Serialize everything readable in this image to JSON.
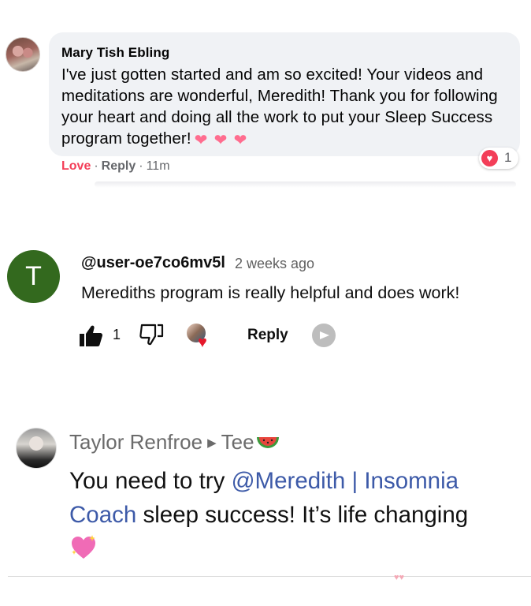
{
  "facebook_comment": {
    "author": "Mary Tish Ebling",
    "text": "I've just gotten started and am so excited! Your videos and meditations are wonderful, Meredith! Thank you for following your heart and doing all the work to put your Sleep Success program together!",
    "emoji": [
      "❤",
      "❤",
      "❤"
    ],
    "reaction_count": "1",
    "actions": {
      "love_label": "Love",
      "separator": "·",
      "reply_label": "Reply",
      "timestamp": "11m"
    },
    "colors": {
      "love": "#f33e58",
      "bubble": "#f0f2f5",
      "muted": "#65676b"
    }
  },
  "youtube_comment": {
    "avatar_letter": "T",
    "handle": "@user-oe7co6mv5l",
    "time": "2 weeks ago",
    "text": "Merediths program is really helpful and does work!",
    "like_count": "1",
    "reply_label": "Reply",
    "icons": [
      "thumbs-up-icon",
      "thumbs-down-icon",
      "creator-heart-icon",
      "translate-icon"
    ],
    "colors": {
      "avatar": "#33691e",
      "heart": "#e5182b",
      "muted": "#606060"
    }
  },
  "instagram_comment": {
    "author": "Taylor Renfroe",
    "arrow": "▶",
    "recipient": "Tee",
    "text_before": "You need to try ",
    "mention": "@Meredith | Insomnia Coach",
    "text_after": " sleep success! It’s life changing",
    "icons": [
      "watermelon-emoji",
      "sparkling-heart-emoji"
    ],
    "colors": {
      "mention": "#3d5aa8",
      "name": "#6b6b6b"
    }
  }
}
